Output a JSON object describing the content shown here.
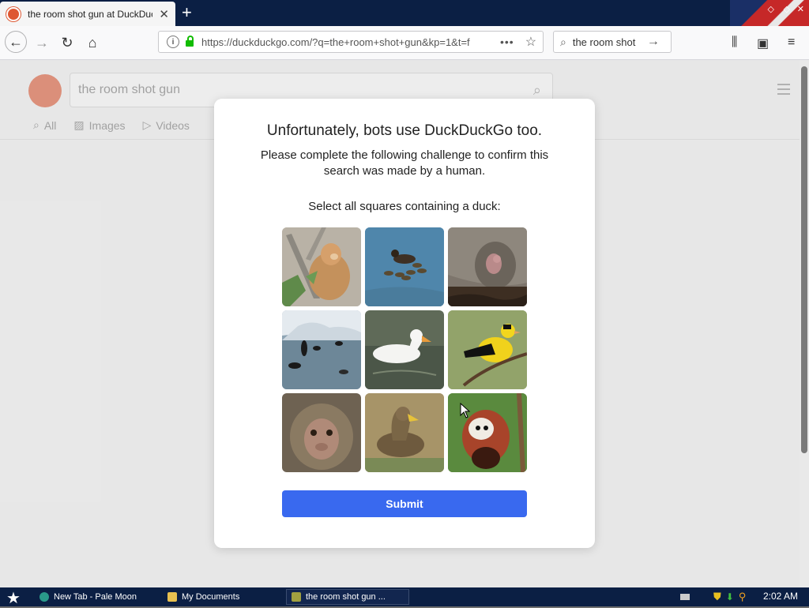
{
  "browser": {
    "tab_title": "the room shot gun at DuckDuckGo",
    "new_tab_glyph": "+",
    "url": "https://duckduckgo.com/?q=the+room+shot+gun&kp=1&t=f",
    "search_box_value": "the room shot",
    "page_actions_glyph": "•••",
    "icons": [
      "back-arrow-icon",
      "forward-arrow-icon",
      "reload-icon",
      "home-icon",
      "info-icon",
      "lock-icon",
      "bookmark-star-icon",
      "search-icon",
      "go-arrow-icon",
      "library-icon",
      "sidebar-icon",
      "menu-icon",
      "close-tab-icon"
    ]
  },
  "ddg": {
    "search_value": "the room shot gun",
    "tabs": [
      "All",
      "Images",
      "Videos"
    ]
  },
  "challenge": {
    "heading": "Unfortunately, bots use DuckDuckGo too.",
    "subtext": "Please complete the following challenge to confirm this search was made by a human.",
    "instruction": "Select all squares containing a duck:",
    "submit_label": "Submit",
    "tiles": [
      {
        "subject": "monkey-on-branch"
      },
      {
        "subject": "duck-with-ducklings"
      },
      {
        "subject": "animal-in-burrow"
      },
      {
        "subject": "penguins-in-water"
      },
      {
        "subject": "white-duck"
      },
      {
        "subject": "yellow-bird"
      },
      {
        "subject": "macaque"
      },
      {
        "subject": "brown-duck"
      },
      {
        "subject": "red-panda"
      }
    ]
  },
  "taskbar": {
    "items": [
      "New Tab - Pale Moon",
      "My Documents",
      "the room shot gun ..."
    ],
    "clock": "2:02 AM"
  },
  "colors": {
    "accent": "#3969ef",
    "ddg_orange": "#de5833",
    "titlebar": "#0b1f44"
  }
}
